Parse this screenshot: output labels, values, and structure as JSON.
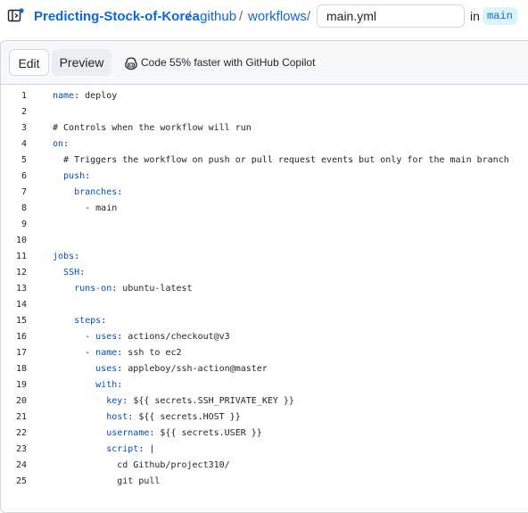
{
  "breadcrumb": {
    "repo": "Predicting-Stock-of-Korea",
    "sep1": "/",
    "folder1": ".github",
    "sep2": "/",
    "folder2": "workflows",
    "sep3": "/",
    "filename_value": "main.yml",
    "in_label": "in",
    "branch": "main"
  },
  "editor": {
    "tab_edit": "Edit",
    "tab_preview": "Preview",
    "copilot_text": "Code 55% faster with GitHub Copilot"
  },
  "code_lines": [
    {
      "n": "1",
      "parts": [
        {
          "t": "name",
          "k": "key"
        },
        {
          "t": ": deploy",
          "k": "value"
        }
      ]
    },
    {
      "n": "2",
      "parts": []
    },
    {
      "n": "3",
      "parts": [
        {
          "t": "# Controls when the workflow will run",
          "k": "comment"
        }
      ]
    },
    {
      "n": "4",
      "parts": [
        {
          "t": "on",
          "k": "key"
        },
        {
          "t": ":",
          "k": "punct"
        }
      ]
    },
    {
      "n": "5",
      "parts": [
        {
          "t": "  # Triggers the workflow on push or pull request events but only for the main branch",
          "k": "comment"
        }
      ]
    },
    {
      "n": "6",
      "parts": [
        {
          "t": "  push",
          "k": "key"
        },
        {
          "t": ":",
          "k": "punct"
        }
      ]
    },
    {
      "n": "7",
      "parts": [
        {
          "t": "    branches",
          "k": "key"
        },
        {
          "t": ":",
          "k": "punct"
        }
      ]
    },
    {
      "n": "8",
      "parts": [
        {
          "t": "      - main",
          "k": "value"
        }
      ]
    },
    {
      "n": "9",
      "parts": []
    },
    {
      "n": "10",
      "parts": []
    },
    {
      "n": "11",
      "parts": [
        {
          "t": "jobs",
          "k": "key"
        },
        {
          "t": ":",
          "k": "punct"
        }
      ]
    },
    {
      "n": "12",
      "parts": [
        {
          "t": "  SSH",
          "k": "key"
        },
        {
          "t": ":",
          "k": "punct"
        }
      ]
    },
    {
      "n": "13",
      "parts": [
        {
          "t": "    runs-on",
          "k": "key"
        },
        {
          "t": ": ubuntu-latest",
          "k": "value"
        }
      ]
    },
    {
      "n": "14",
      "parts": []
    },
    {
      "n": "15",
      "parts": [
        {
          "t": "    steps",
          "k": "key"
        },
        {
          "t": ":",
          "k": "punct"
        }
      ]
    },
    {
      "n": "16",
      "parts": [
        {
          "t": "      - ",
          "k": "punct"
        },
        {
          "t": "uses",
          "k": "key"
        },
        {
          "t": ": actions/checkout@v3",
          "k": "value"
        }
      ]
    },
    {
      "n": "17",
      "parts": [
        {
          "t": "      - ",
          "k": "punct"
        },
        {
          "t": "name",
          "k": "key"
        },
        {
          "t": ": ssh to ec2",
          "k": "value"
        }
      ]
    },
    {
      "n": "18",
      "parts": [
        {
          "t": "        uses",
          "k": "key"
        },
        {
          "t": ": appleboy/ssh-action@master",
          "k": "value"
        }
      ]
    },
    {
      "n": "19",
      "parts": [
        {
          "t": "        with",
          "k": "key"
        },
        {
          "t": ":",
          "k": "punct"
        }
      ]
    },
    {
      "n": "20",
      "parts": [
        {
          "t": "          key",
          "k": "key"
        },
        {
          "t": ": ${{ secrets.SSH_PRIVATE_KEY }}",
          "k": "value"
        }
      ]
    },
    {
      "n": "21",
      "parts": [
        {
          "t": "          host",
          "k": "key"
        },
        {
          "t": ": ${{ secrets.HOST }}",
          "k": "value"
        }
      ]
    },
    {
      "n": "22",
      "parts": [
        {
          "t": "          username",
          "k": "key"
        },
        {
          "t": ": ${{ secrets.USER }}",
          "k": "value"
        }
      ]
    },
    {
      "n": "23",
      "parts": [
        {
          "t": "          script",
          "k": "key"
        },
        {
          "t": ": |",
          "k": "value"
        }
      ]
    },
    {
      "n": "24",
      "parts": [
        {
          "t": "            cd Github/project310/",
          "k": "value"
        }
      ]
    },
    {
      "n": "25",
      "parts": [
        {
          "t": "            git pull",
          "k": "value"
        }
      ]
    }
  ],
  "icons": {
    "file_tree": "file-tree-icon",
    "copilot": "copilot-icon"
  },
  "colors": {
    "link": "#0969da",
    "key": "#0550ae",
    "badge_bg": "#ddf4ff"
  }
}
